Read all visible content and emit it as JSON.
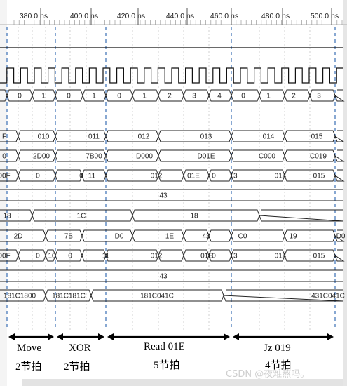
{
  "timeline": {
    "ticks": [
      "380.0 ns",
      "400.0 ns",
      "420.0 ns",
      "440.0 ns",
      "460.0 ns",
      "480.0 ns",
      "500.0 ns"
    ]
  },
  "rows": [
    {
      "kind": "bus",
      "labels": [
        "0",
        "1",
        "0",
        "1",
        "0",
        "1",
        "2",
        "3",
        "4",
        "0",
        "1",
        "2",
        "3",
        "0"
      ]
    },
    {
      "kind": "bus",
      "labels": [
        "F",
        "010",
        "011",
        "012",
        "013",
        "014",
        "015"
      ]
    },
    {
      "kind": "bus",
      "labels": [
        "0",
        "2D00",
        "7B00",
        "D000",
        "D01E",
        "C000",
        "C019"
      ]
    },
    {
      "kind": "bus",
      "labels": [
        "00F",
        "0",
        "0",
        "11",
        "012",
        "01E",
        "0",
        "13",
        "014",
        "015"
      ]
    },
    {
      "kind": "bus",
      "labels": [
        "43"
      ]
    },
    {
      "kind": "bus",
      "labels": [
        "18",
        "1C",
        "18"
      ]
    },
    {
      "kind": "bus",
      "labels": [
        "2D",
        "7B",
        "D0",
        "1E",
        "43",
        "C0",
        "19",
        "D0"
      ]
    },
    {
      "kind": "bus",
      "labels": [
        "00F",
        "0",
        "10",
        "0",
        "11",
        "012",
        "01E",
        "0",
        "13",
        "014",
        "015"
      ]
    },
    {
      "kind": "bus",
      "labels": [
        "43"
      ]
    },
    {
      "kind": "bus",
      "labels": [
        "181C1800",
        "181C181C",
        "181C041C",
        "431C041C"
      ]
    }
  ],
  "phases": [
    {
      "name": "Move",
      "beats": "2节拍"
    },
    {
      "name": "XOR",
      "beats": "2节拍"
    },
    {
      "name": "Read 01E",
      "beats": "5节拍"
    },
    {
      "name": "Jz 019",
      "beats": "4节拍"
    }
  ],
  "watermark": "CSDN @夜难熬吗。"
}
